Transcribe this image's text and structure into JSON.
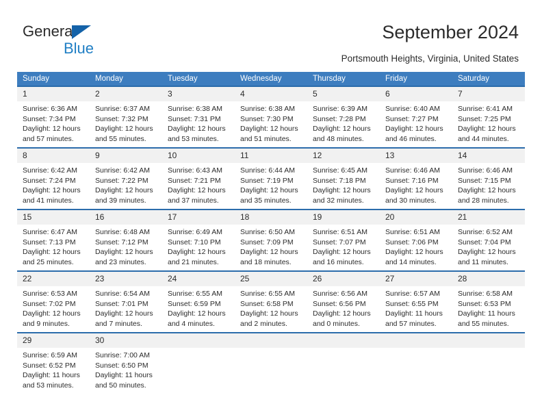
{
  "brand": {
    "name_top": "General",
    "name_bottom": "Blue",
    "accent_color": "#1f7ec4",
    "triangle_color": "#1462a8"
  },
  "header": {
    "title": "September 2024",
    "subtitle": "Portsmouth Heights, Virginia, United States"
  },
  "calendar": {
    "header_background": "#3d7dbf",
    "row_separator_color": "#2b6cab",
    "daynum_background": "#f1f1f1",
    "weekdays": [
      "Sunday",
      "Monday",
      "Tuesday",
      "Wednesday",
      "Thursday",
      "Friday",
      "Saturday"
    ],
    "weeks": [
      [
        {
          "day": "1",
          "sunrise": "Sunrise: 6:36 AM",
          "sunset": "Sunset: 7:34 PM",
          "daylight_1": "Daylight: 12 hours",
          "daylight_2": "and 57 minutes."
        },
        {
          "day": "2",
          "sunrise": "Sunrise: 6:37 AM",
          "sunset": "Sunset: 7:32 PM",
          "daylight_1": "Daylight: 12 hours",
          "daylight_2": "and 55 minutes."
        },
        {
          "day": "3",
          "sunrise": "Sunrise: 6:38 AM",
          "sunset": "Sunset: 7:31 PM",
          "daylight_1": "Daylight: 12 hours",
          "daylight_2": "and 53 minutes."
        },
        {
          "day": "4",
          "sunrise": "Sunrise: 6:38 AM",
          "sunset": "Sunset: 7:30 PM",
          "daylight_1": "Daylight: 12 hours",
          "daylight_2": "and 51 minutes."
        },
        {
          "day": "5",
          "sunrise": "Sunrise: 6:39 AM",
          "sunset": "Sunset: 7:28 PM",
          "daylight_1": "Daylight: 12 hours",
          "daylight_2": "and 48 minutes."
        },
        {
          "day": "6",
          "sunrise": "Sunrise: 6:40 AM",
          "sunset": "Sunset: 7:27 PM",
          "daylight_1": "Daylight: 12 hours",
          "daylight_2": "and 46 minutes."
        },
        {
          "day": "7",
          "sunrise": "Sunrise: 6:41 AM",
          "sunset": "Sunset: 7:25 PM",
          "daylight_1": "Daylight: 12 hours",
          "daylight_2": "and 44 minutes."
        }
      ],
      [
        {
          "day": "8",
          "sunrise": "Sunrise: 6:42 AM",
          "sunset": "Sunset: 7:24 PM",
          "daylight_1": "Daylight: 12 hours",
          "daylight_2": "and 41 minutes."
        },
        {
          "day": "9",
          "sunrise": "Sunrise: 6:42 AM",
          "sunset": "Sunset: 7:22 PM",
          "daylight_1": "Daylight: 12 hours",
          "daylight_2": "and 39 minutes."
        },
        {
          "day": "10",
          "sunrise": "Sunrise: 6:43 AM",
          "sunset": "Sunset: 7:21 PM",
          "daylight_1": "Daylight: 12 hours",
          "daylight_2": "and 37 minutes."
        },
        {
          "day": "11",
          "sunrise": "Sunrise: 6:44 AM",
          "sunset": "Sunset: 7:19 PM",
          "daylight_1": "Daylight: 12 hours",
          "daylight_2": "and 35 minutes."
        },
        {
          "day": "12",
          "sunrise": "Sunrise: 6:45 AM",
          "sunset": "Sunset: 7:18 PM",
          "daylight_1": "Daylight: 12 hours",
          "daylight_2": "and 32 minutes."
        },
        {
          "day": "13",
          "sunrise": "Sunrise: 6:46 AM",
          "sunset": "Sunset: 7:16 PM",
          "daylight_1": "Daylight: 12 hours",
          "daylight_2": "and 30 minutes."
        },
        {
          "day": "14",
          "sunrise": "Sunrise: 6:46 AM",
          "sunset": "Sunset: 7:15 PM",
          "daylight_1": "Daylight: 12 hours",
          "daylight_2": "and 28 minutes."
        }
      ],
      [
        {
          "day": "15",
          "sunrise": "Sunrise: 6:47 AM",
          "sunset": "Sunset: 7:13 PM",
          "daylight_1": "Daylight: 12 hours",
          "daylight_2": "and 25 minutes."
        },
        {
          "day": "16",
          "sunrise": "Sunrise: 6:48 AM",
          "sunset": "Sunset: 7:12 PM",
          "daylight_1": "Daylight: 12 hours",
          "daylight_2": "and 23 minutes."
        },
        {
          "day": "17",
          "sunrise": "Sunrise: 6:49 AM",
          "sunset": "Sunset: 7:10 PM",
          "daylight_1": "Daylight: 12 hours",
          "daylight_2": "and 21 minutes."
        },
        {
          "day": "18",
          "sunrise": "Sunrise: 6:50 AM",
          "sunset": "Sunset: 7:09 PM",
          "daylight_1": "Daylight: 12 hours",
          "daylight_2": "and 18 minutes."
        },
        {
          "day": "19",
          "sunrise": "Sunrise: 6:51 AM",
          "sunset": "Sunset: 7:07 PM",
          "daylight_1": "Daylight: 12 hours",
          "daylight_2": "and 16 minutes."
        },
        {
          "day": "20",
          "sunrise": "Sunrise: 6:51 AM",
          "sunset": "Sunset: 7:06 PM",
          "daylight_1": "Daylight: 12 hours",
          "daylight_2": "and 14 minutes."
        },
        {
          "day": "21",
          "sunrise": "Sunrise: 6:52 AM",
          "sunset": "Sunset: 7:04 PM",
          "daylight_1": "Daylight: 12 hours",
          "daylight_2": "and 11 minutes."
        }
      ],
      [
        {
          "day": "22",
          "sunrise": "Sunrise: 6:53 AM",
          "sunset": "Sunset: 7:02 PM",
          "daylight_1": "Daylight: 12 hours",
          "daylight_2": "and 9 minutes."
        },
        {
          "day": "23",
          "sunrise": "Sunrise: 6:54 AM",
          "sunset": "Sunset: 7:01 PM",
          "daylight_1": "Daylight: 12 hours",
          "daylight_2": "and 7 minutes."
        },
        {
          "day": "24",
          "sunrise": "Sunrise: 6:55 AM",
          "sunset": "Sunset: 6:59 PM",
          "daylight_1": "Daylight: 12 hours",
          "daylight_2": "and 4 minutes."
        },
        {
          "day": "25",
          "sunrise": "Sunrise: 6:55 AM",
          "sunset": "Sunset: 6:58 PM",
          "daylight_1": "Daylight: 12 hours",
          "daylight_2": "and 2 minutes."
        },
        {
          "day": "26",
          "sunrise": "Sunrise: 6:56 AM",
          "sunset": "Sunset: 6:56 PM",
          "daylight_1": "Daylight: 12 hours",
          "daylight_2": "and 0 minutes."
        },
        {
          "day": "27",
          "sunrise": "Sunrise: 6:57 AM",
          "sunset": "Sunset: 6:55 PM",
          "daylight_1": "Daylight: 11 hours",
          "daylight_2": "and 57 minutes."
        },
        {
          "day": "28",
          "sunrise": "Sunrise: 6:58 AM",
          "sunset": "Sunset: 6:53 PM",
          "daylight_1": "Daylight: 11 hours",
          "daylight_2": "and 55 minutes."
        }
      ],
      [
        {
          "day": "29",
          "sunrise": "Sunrise: 6:59 AM",
          "sunset": "Sunset: 6:52 PM",
          "daylight_1": "Daylight: 11 hours",
          "daylight_2": "and 53 minutes."
        },
        {
          "day": "30",
          "sunrise": "Sunrise: 7:00 AM",
          "sunset": "Sunset: 6:50 PM",
          "daylight_1": "Daylight: 11 hours",
          "daylight_2": "and 50 minutes."
        },
        {
          "day": "",
          "sunrise": "",
          "sunset": "",
          "daylight_1": "",
          "daylight_2": ""
        },
        {
          "day": "",
          "sunrise": "",
          "sunset": "",
          "daylight_1": "",
          "daylight_2": ""
        },
        {
          "day": "",
          "sunrise": "",
          "sunset": "",
          "daylight_1": "",
          "daylight_2": ""
        },
        {
          "day": "",
          "sunrise": "",
          "sunset": "",
          "daylight_1": "",
          "daylight_2": ""
        },
        {
          "day": "",
          "sunrise": "",
          "sunset": "",
          "daylight_1": "",
          "daylight_2": ""
        }
      ]
    ]
  }
}
